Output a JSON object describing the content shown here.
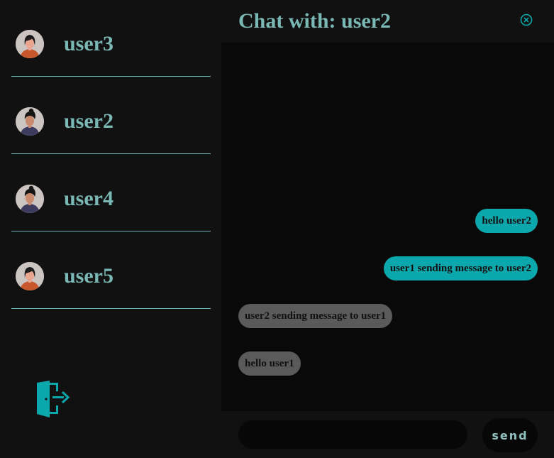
{
  "sidebar": {
    "users": [
      {
        "name": "user3",
        "avatar": "female-avatar-icon"
      },
      {
        "name": "user2",
        "avatar": "male-avatar-icon"
      },
      {
        "name": "user4",
        "avatar": "male-avatar-icon"
      },
      {
        "name": "user5",
        "avatar": "female-avatar-icon"
      }
    ],
    "logout_icon": "logout-door-icon"
  },
  "chat": {
    "title": "Chat with: user2",
    "close_icon": "close-circle-icon",
    "messages": [
      {
        "text": "hello user2",
        "direction": "sent"
      },
      {
        "text": "user1 sending message to user2",
        "direction": "sent"
      },
      {
        "text": "user2 sending message to user1",
        "direction": "received"
      },
      {
        "text": "hello user1",
        "direction": "received"
      }
    ]
  },
  "composer": {
    "input_value": "",
    "input_placeholder": "",
    "send_label": "send"
  },
  "colors": {
    "accent": "#0aa8ad",
    "title_text": "#7ab8b6",
    "received_bubble": "#5a5a5a",
    "background": "#111111",
    "chat_background": "#090909"
  }
}
